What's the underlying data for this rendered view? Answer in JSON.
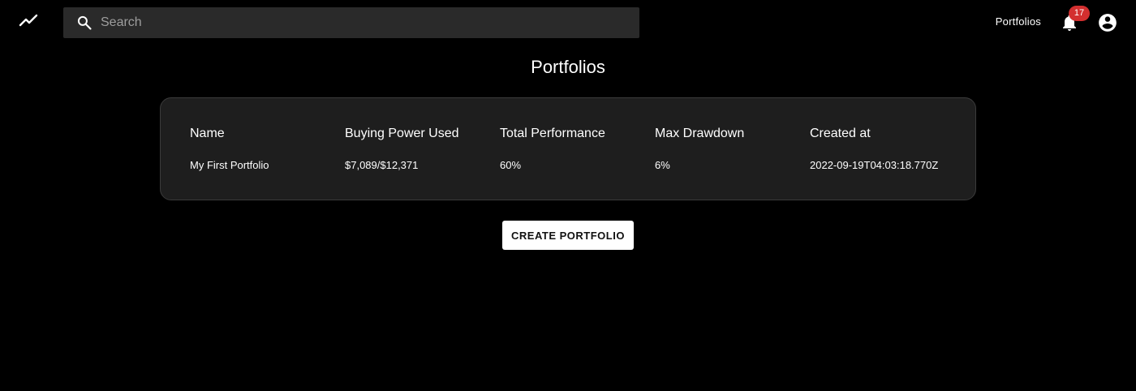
{
  "header": {
    "search_placeholder": "Search",
    "nav_portfolios": "Portfolios",
    "notification_count": "17",
    "icons": [
      "trending-line-icon",
      "search-icon",
      "bell-icon",
      "account-circle-icon"
    ]
  },
  "main": {
    "title": "Portfolios",
    "table": {
      "columns": [
        "Name",
        "Buying Power Used",
        "Total Performance",
        "Max Drawdown",
        "Created at"
      ],
      "rows": [
        [
          "My First Portfolio",
          "$7,089/$12,371",
          "60%",
          "6%",
          "2022-09-19T04:03:18.770Z"
        ]
      ]
    },
    "create_button": "CREATE PORTFOLIO"
  },
  "colors": {
    "background": "#000000",
    "search_bg": "#2a2a2a",
    "card_bg": "#1e1e1e",
    "badge": "#d32f2f",
    "button_bg": "#ffffff"
  }
}
